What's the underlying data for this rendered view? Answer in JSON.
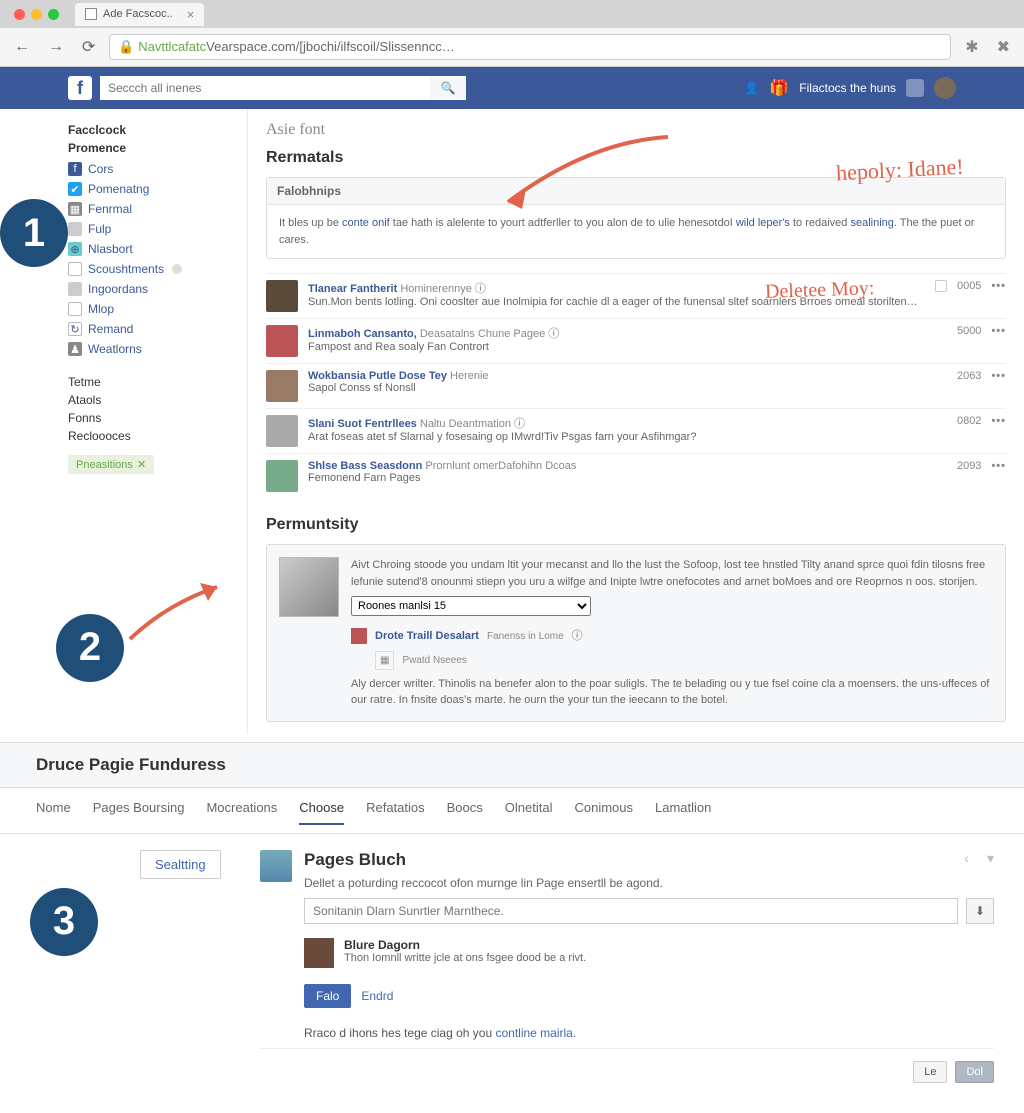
{
  "browser": {
    "tab_title": "Ade Facscoc..",
    "url_prefix": "Navttlcafatc",
    "url_rest": "Vearspace.com/[jbochi/ilfscoil/Slissenncc…"
  },
  "fb_bar": {
    "search_placeholder": "Seccch all inenes",
    "right_label": "Filactocs the huns"
  },
  "left_nav": {
    "h1": "Facclcock",
    "h2": "Promence",
    "items": [
      "Cors",
      "Pomenatng",
      "Fenrmal",
      "Fulp",
      "Nlasbort",
      "Scoushtments",
      "Ingoordans",
      "Mlop",
      "Remand",
      "Weatlorns"
    ],
    "sec2": [
      "Tetme",
      "Ataols",
      "Fonns",
      "Recloooces"
    ],
    "promo": "Pneasitions"
  },
  "main": {
    "page_title": "Asie font",
    "section1": "Rermatals",
    "notice_head": "Falobhnips",
    "notice_body_a": "It bles up be ",
    "notice_link1": "conte onif",
    "notice_body_b": " tae hath is alelente to yourt adtferller to you alon de to ulie henesotdoI ",
    "notice_link2": "wild leper's",
    "notice_body_c": " to redaived ",
    "notice_link3": "sealining",
    "notice_body_d": ". The the puet or cares.",
    "hw1": "hepoly: Idane!",
    "hw2": "Deletee Moy:",
    "feed": [
      {
        "title": "Tlanear Fantherit",
        "sub": "Hominerennye",
        "desc": "Sun.Mon bents lotling. Oni cooslter aue Inolmipia for cachie dl a eager of the funensal sltef soarnlers Brroes omeal storilten…",
        "count": "0005"
      },
      {
        "title": "Linmaboh Cansanto,",
        "sub": "Deasatalns Chune Pagee",
        "desc": "Fampost and Rea soaly Fan Contrort",
        "count": "5000"
      },
      {
        "title": "Wokbansia Putle Dose Tey",
        "sub": "Herenie",
        "desc": "Sapol Conss sf Nonsll",
        "count": "2063"
      },
      {
        "title": "Slani Suot Fentrllees",
        "sub": "Naltu Deantmation",
        "desc": "Arat foseas atet sf Slarnal y fosesaing op IMwrd!Tiv Psgas farn your Asfihmgar?",
        "count": "0802"
      },
      {
        "title": "Shlse Bass Seasdonn",
        "sub": "Prornlunt omerDafohihn Dcoas",
        "desc": "Femonend Farn Pages",
        "count": "2093"
      }
    ],
    "section2": "Permuntsity",
    "perm_desc": "Aivt Chroing stoode you undam ltit your mecanst and llo the lust the Sofoop, lost tee hnstled Tilty anand sprce quoi fdin tilosns free lefunie sutend'8 onounmi stiepn you uru a wilfge and Inipte lwtre onefocotes and arnet boMoes and ore Reoprnos n oos. storijen.",
    "perm_select": "Roones manlsi 15",
    "perm_user": "Drote Traill Desalart",
    "perm_user_sub": "Fanenss in Lome",
    "perm_user_line2": "Pwatd Nseees",
    "perm_foot": "Aly dercer wrilter. Thinolis na benefer alon to the poar suligls. The te belading ou y tue fsel coine cla a moensers. the uns-uffeces of our ratre. In fnsite doas's marte. he ourn the your tun the ieecann to the botel."
  },
  "sec3": {
    "title": "Druce Pagie Funduress",
    "tabs": [
      "Nome",
      "Pages Boursing",
      "Mocreations",
      "Choose",
      "Refatatios",
      "Boocs",
      "Olnetital",
      "Conimous",
      "Lamatlion"
    ],
    "active_tab": 3,
    "sidebar_btn": "Sealtting",
    "panel_title": "Pages Bluch",
    "panel_sub": "Dellet a poturding reccocot ofon murnge lin Page ensertll be agond.",
    "input_placeholder": "Sonitanin Dlarn Sunrtler Marnthece.",
    "user_name": "Blure Dagorn",
    "user_sub": "Thon Iomnll writte jcle at ons fsgee dood be a rivt.",
    "btn_primary": "Falo",
    "btn_cancel": "Endrd",
    "foot_a": "Rraco d ihons hes tege ciag oh you ",
    "foot_link": "contline mairla",
    "foot_b": ".",
    "action1": "Le",
    "action2": "Dol"
  },
  "steps": {
    "s1": "1",
    "s2": "2",
    "s3": "3"
  }
}
